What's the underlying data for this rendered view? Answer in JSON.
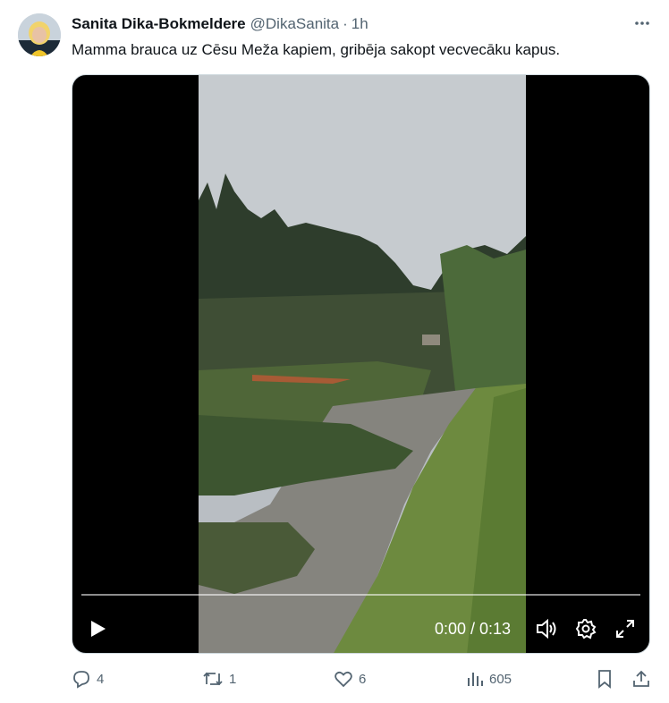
{
  "tweet": {
    "author_name": "Sanita Dika-Bokmeldere",
    "handle": "@DikaSanita",
    "separator": "·",
    "time": "1h",
    "text": "Mamma brauca uz Cēsu Meža kapiem, gribēja sakopt vecvecāku kapus."
  },
  "video": {
    "time_display": "0:00 / 0:13",
    "progress_fraction": 0.0
  },
  "actions": {
    "replies": "4",
    "retweets": "1",
    "likes": "6",
    "views": "605"
  },
  "icons": {
    "more": "more-horizontal-icon",
    "play": "play-icon",
    "volume": "volume-icon",
    "settings": "gear-icon",
    "fullscreen": "fullscreen-icon",
    "reply": "reply-icon",
    "retweet": "retweet-icon",
    "like": "heart-icon",
    "views": "analytics-icon",
    "bookmark": "bookmark-icon",
    "share": "share-icon"
  }
}
